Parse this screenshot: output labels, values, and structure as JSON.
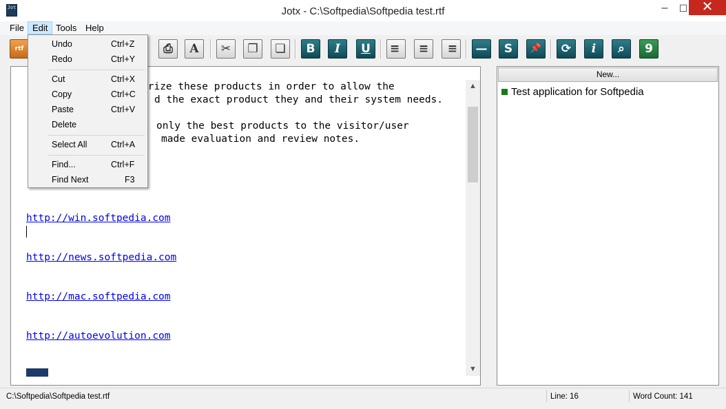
{
  "window": {
    "app_icon": "Jot",
    "title": "Jotx - C:\\Softpedia\\Softpedia test.rtf",
    "minimize_glyph": "–",
    "maximize_glyph": "☐",
    "close_glyph": "✕"
  },
  "menu": {
    "file": "File",
    "edit": "Edit",
    "tools": "Tools",
    "help": "Help"
  },
  "edit_menu": {
    "undo": {
      "label": "Undo",
      "shortcut": "Ctrl+Z"
    },
    "redo": {
      "label": "Redo",
      "shortcut": "Ctrl+Y"
    },
    "cut": {
      "label": "Cut",
      "shortcut": "Ctrl+X"
    },
    "copy": {
      "label": "Copy",
      "shortcut": "Ctrl+C"
    },
    "paste": {
      "label": "Paste",
      "shortcut": "Ctrl+V"
    },
    "delete": {
      "label": "Delete",
      "shortcut": ""
    },
    "select_all": {
      "label": "Select All",
      "shortcut": "Ctrl+A"
    },
    "find": {
      "label": "Find...",
      "shortcut": "Ctrl+F"
    },
    "find_next": {
      "label": "Find Next",
      "shortcut": "F3"
    }
  },
  "toolbar": {
    "icons": [
      "new-file-icon",
      "print-icon",
      "font-icon",
      "cut-icon",
      "copy-icon",
      "paste-icon",
      "bold-icon",
      "italic-icon",
      "underline-icon",
      "align-left-icon",
      "align-center-icon",
      "align-right-icon",
      "horizontal-line-icon",
      "spellcheck-icon",
      "pin-icon",
      "refresh-icon",
      "info-icon",
      "search-icon",
      "calendar-icon"
    ],
    "new_glyph": "rtf",
    "print_glyph": "⎙",
    "font_glyph": "A",
    "cut_glyph": "✂",
    "copy_glyph": "❐",
    "paste_glyph": "❏",
    "bold_glyph": "B",
    "italic_glyph": "I",
    "underline_glyph": "U",
    "align_left_glyph": "≡",
    "align_center_glyph": "≡",
    "align_right_glyph": "≡",
    "hr_glyph": "—",
    "spell_glyph": "S",
    "pin_glyph": "📌",
    "refresh_glyph": "⟳",
    "info_glyph": "i",
    "search_glyph": "⌕",
    "calendar_glyph": "9"
  },
  "editor": {
    "line1": "prize these products in order to allow the",
    "line2": "d the exact product they and their system needs.",
    "line3": "only the best products to the visitor/user",
    "line4": "made evaluation and review notes.",
    "link1": "http://win.softpedia.com",
    "link2": "http://news.softpedia.com",
    "link3": "http://mac.softpedia.com",
    "link4": "http://autoevolution.com",
    "scroll_up": "▲",
    "scroll_down": "▼"
  },
  "notes_panel": {
    "new_button": "New...",
    "items": [
      "Test application for Softpedia"
    ]
  },
  "status": {
    "path": "C:\\Softpedia\\Softpedia test.rtf",
    "line": "Line: 16",
    "word_count": "Word Count: 141"
  },
  "colors": {
    "toolbar_button": "#1b5f6b",
    "link": "#0000ee",
    "note_bullet": "#1a7a1a",
    "close_button": "#c7281e",
    "menu_highlight": "#cde8ff"
  }
}
